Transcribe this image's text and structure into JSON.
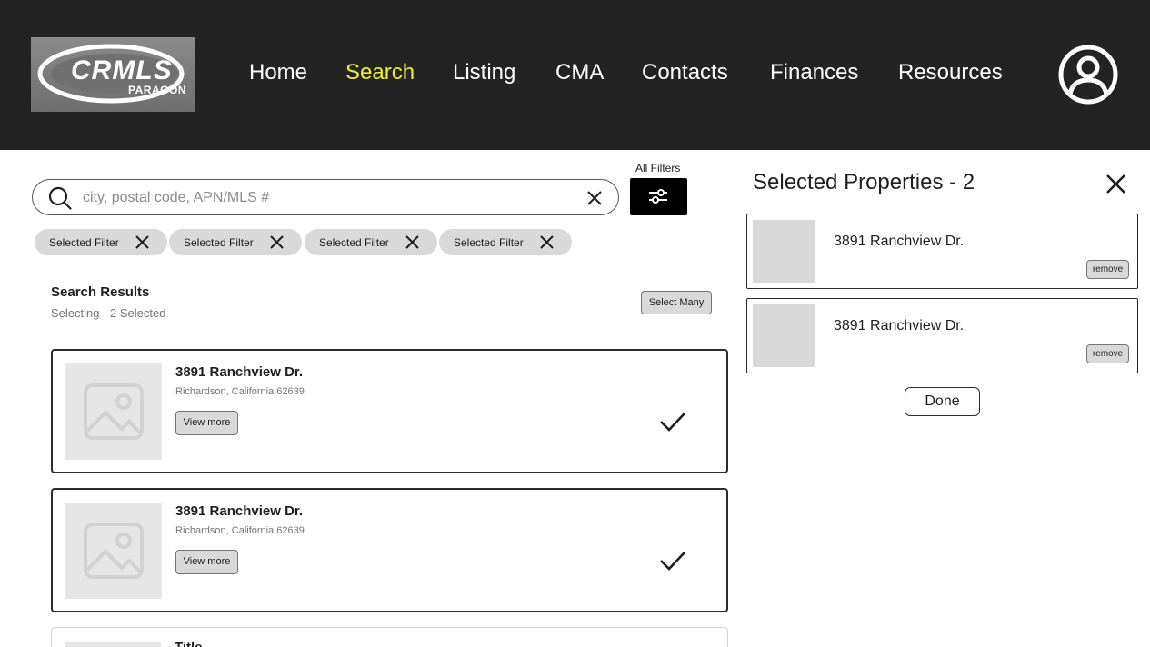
{
  "header": {
    "logo": {
      "main": "CRMLS",
      "sub": "PARAGON"
    },
    "nav": [
      {
        "label": "Home",
        "active": false
      },
      {
        "label": "Search",
        "active": true
      },
      {
        "label": "Listing",
        "active": false
      },
      {
        "label": "CMA",
        "active": false
      },
      {
        "label": "Contacts",
        "active": false
      },
      {
        "label": "Finances",
        "active": false
      },
      {
        "label": "Resources",
        "active": false
      }
    ],
    "active_color": "#f2ee2a",
    "avatar_icon": "user-circle-icon"
  },
  "search": {
    "placeholder": "city, postal code, APN/MLS #",
    "value": "",
    "filters_label": "All Filters",
    "chips": [
      {
        "label": "Selected Filter"
      },
      {
        "label": "Selected Filter"
      },
      {
        "label": "Selected Filter"
      },
      {
        "label": "Selected Filter"
      }
    ]
  },
  "results": {
    "title": "Search Results",
    "subtitle": "Selecting - 2 Selected",
    "select_many_label": "Select Many",
    "items": [
      {
        "title": "3891 Ranchview Dr.",
        "address": "Richardson, California 62639",
        "button": "View more",
        "selected": true
      },
      {
        "title": "3891 Ranchview Dr.",
        "address": "Richardson, California 62639",
        "button": "View more",
        "selected": true
      },
      {
        "title": "Title",
        "address": "",
        "button": "",
        "selected": false
      }
    ]
  },
  "panel": {
    "title": "Selected Properties - 2",
    "items": [
      {
        "title": "3891 Ranchview Dr.",
        "remove_label": "remove"
      },
      {
        "title": "3891 Ranchview Dr.",
        "remove_label": "remove"
      }
    ],
    "done_label": "Done"
  }
}
